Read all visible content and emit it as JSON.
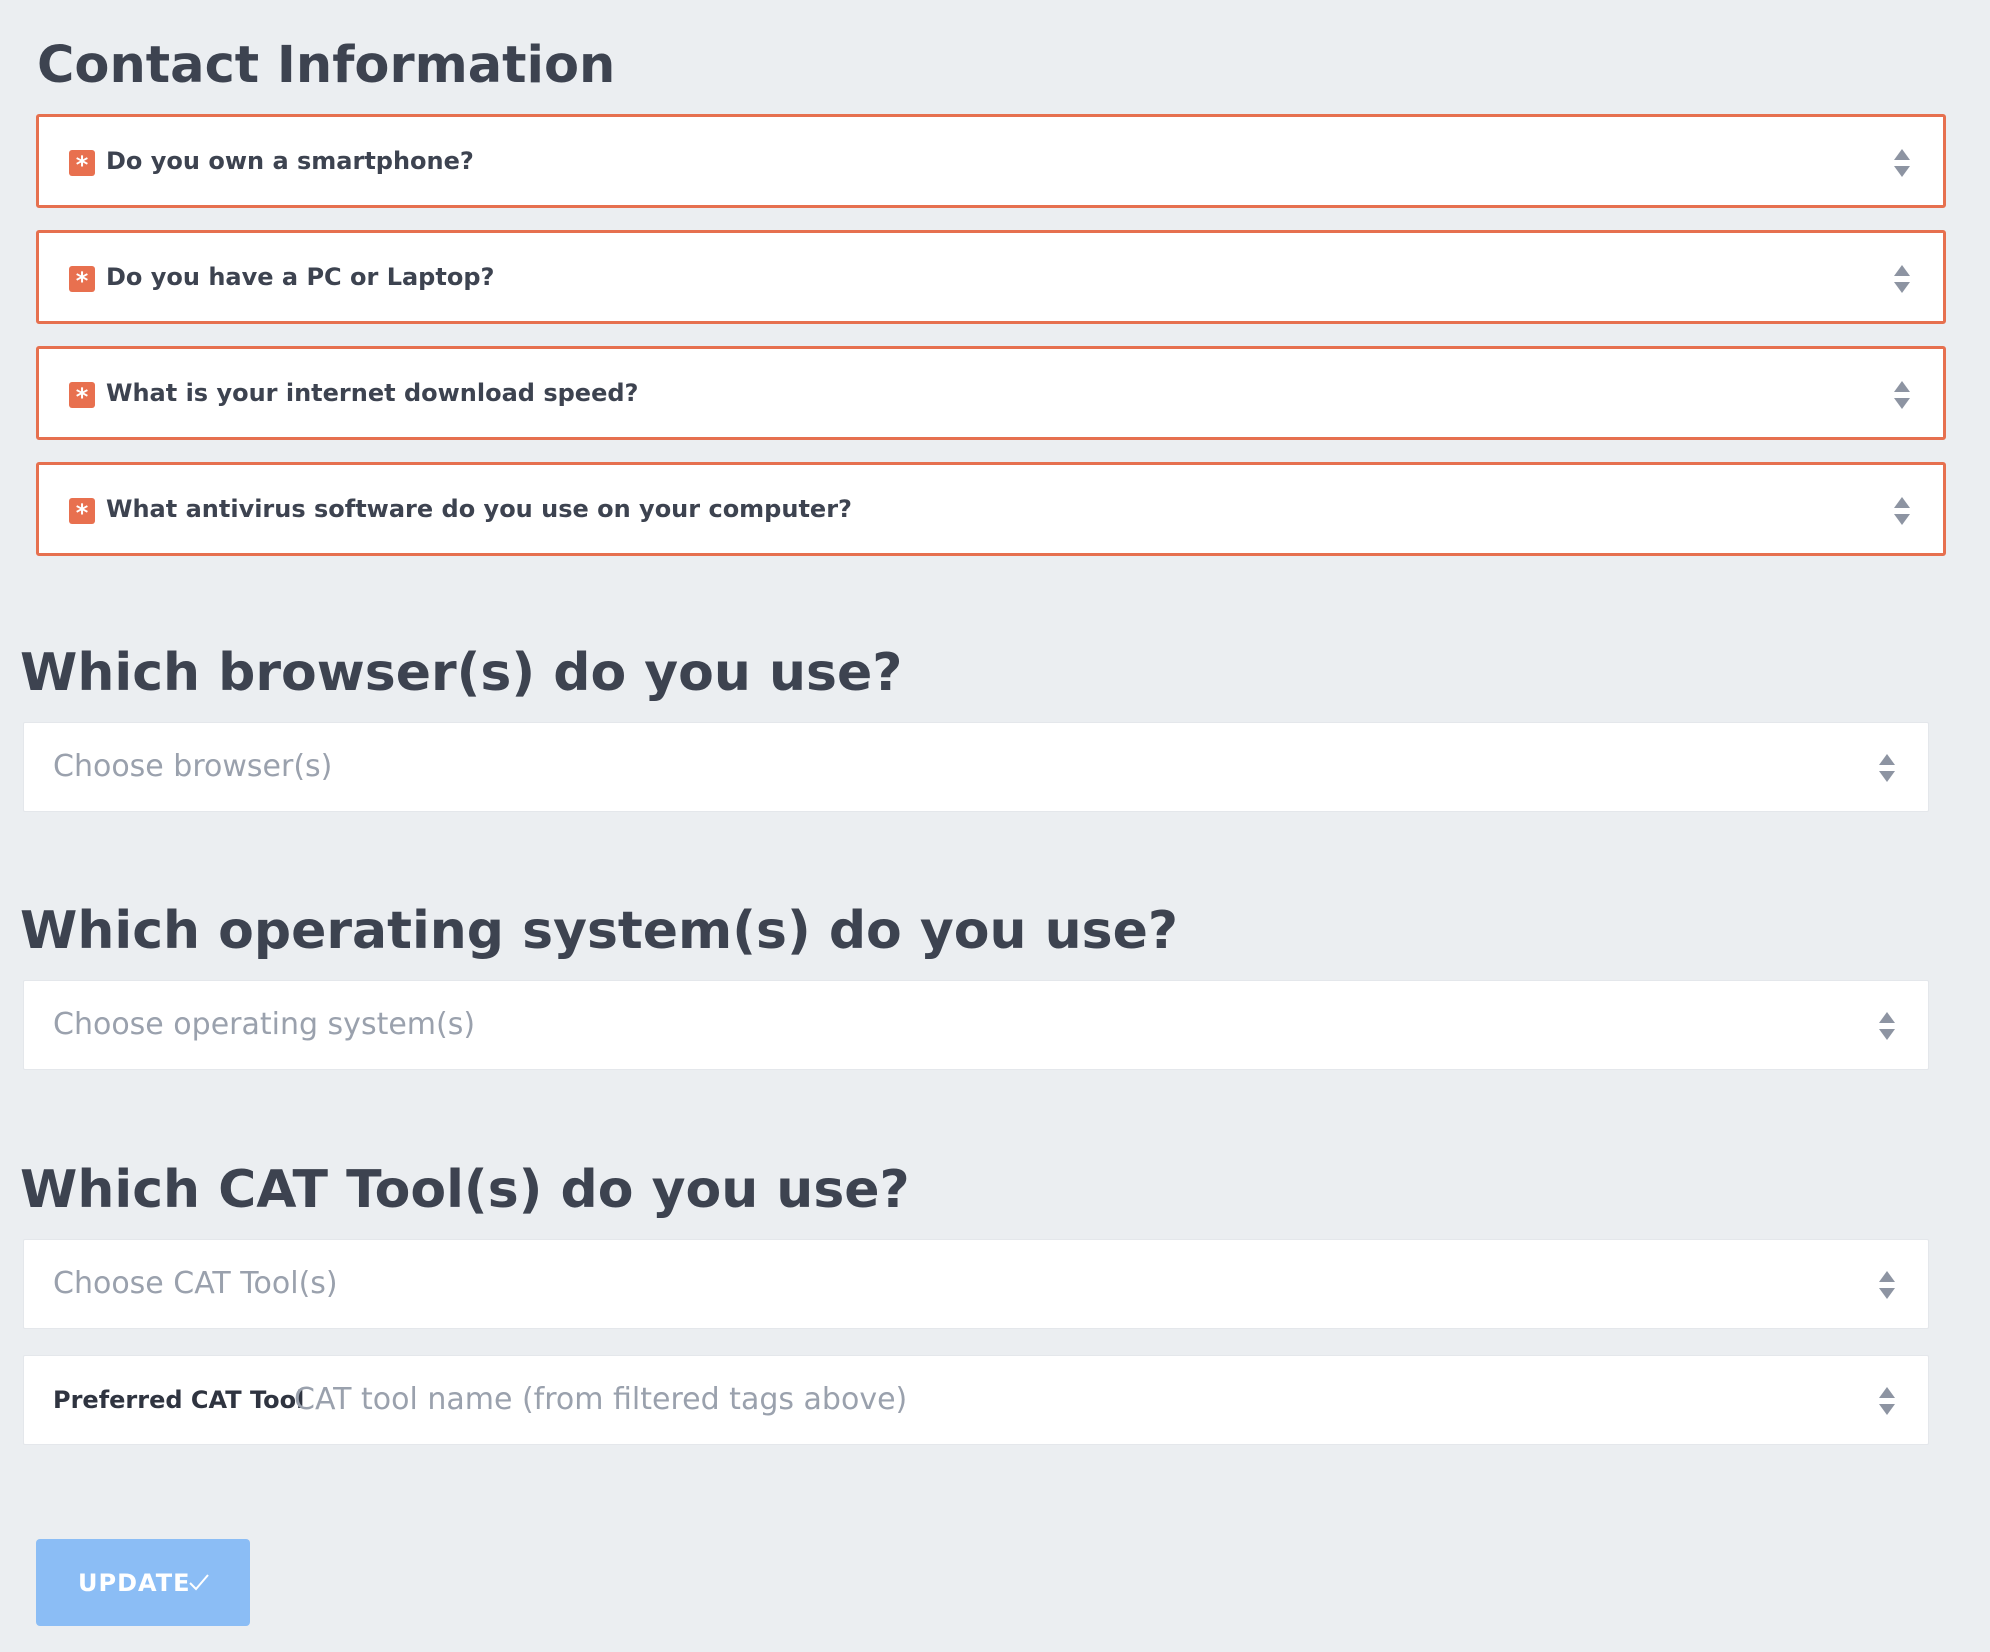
{
  "contact": {
    "title": "Contact Information",
    "required_symbol": "*",
    "questions": [
      {
        "label": "Do you own a smartphone?"
      },
      {
        "label": "Do you have a PC or Laptop?"
      },
      {
        "label": "What is your internet download speed?"
      },
      {
        "label": "What antivirus software do you use on your computer?"
      }
    ]
  },
  "browsers": {
    "title": "Which browser(s) do you use?",
    "placeholder": "Choose browser(s)"
  },
  "operating_systems": {
    "title": "Which operating system(s) do you use?",
    "placeholder": "Choose operating system(s)"
  },
  "cat_tools": {
    "title": "Which CAT Tool(s) do you use?",
    "placeholder": "Choose CAT Tool(s)",
    "preferred_label": "Preferred CAT Tool",
    "preferred_placeholder": "CAT tool name (from filtered tags above)"
  },
  "update_button": {
    "label": "UPDATE",
    "icon": "check-icon"
  },
  "colors": {
    "background": "#ebeef1",
    "required_border": "#e6704f",
    "button": "#8bbdf5",
    "text": "#3d4350",
    "placeholder": "#9aa1ad"
  }
}
